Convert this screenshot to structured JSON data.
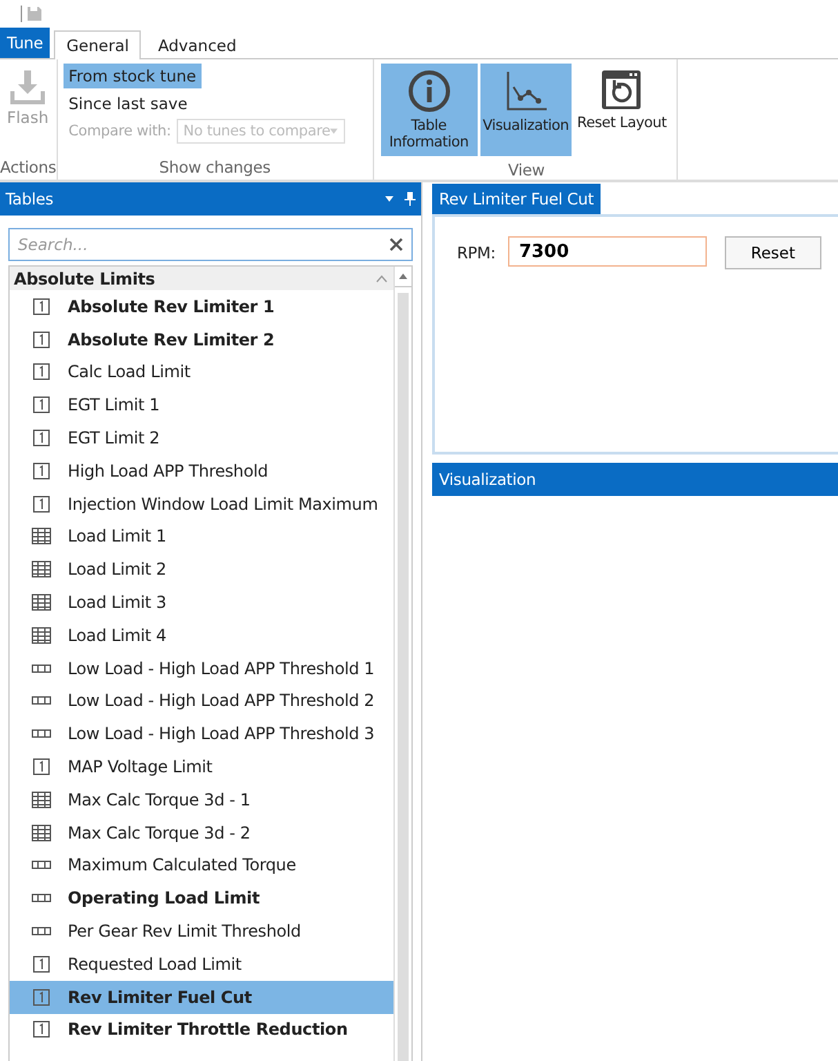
{
  "ribbon": {
    "app_tab": "Tune",
    "tabs": [
      {
        "label": "General",
        "selected": true
      },
      {
        "label": "Advanced",
        "selected": false
      }
    ],
    "groups": [
      {
        "kind": "actions",
        "label": "Actions",
        "flash": {
          "label": "Flash",
          "disabled": true
        }
      },
      {
        "kind": "changes",
        "label": "Show changes",
        "options": [
          {
            "label": "From stock tune",
            "selected": true
          },
          {
            "label": "Since last save",
            "selected": false
          }
        ],
        "compare": {
          "label": "Compare with:",
          "placeholder": "No tunes to compare",
          "disabled": true
        }
      },
      {
        "kind": "view",
        "label": "View",
        "buttons": [
          {
            "kind": "info",
            "label": "Table Information",
            "selected": true
          },
          {
            "kind": "chart",
            "label": "Visualization",
            "selected": true
          },
          {
            "kind": "reset",
            "label": "Reset Layout",
            "selected": false
          }
        ]
      }
    ]
  },
  "tables_panel": {
    "title": "Tables",
    "search": {
      "placeholder": "Search..."
    },
    "group": {
      "label": "Absolute Limits",
      "expanded": true
    },
    "items": [
      {
        "kind": "scalar",
        "label": "Absolute Rev Limiter 1",
        "modified": true,
        "selected": false
      },
      {
        "kind": "scalar",
        "label": "Absolute Rev Limiter 2",
        "modified": true,
        "selected": false
      },
      {
        "kind": "scalar",
        "label": "Calc Load Limit",
        "modified": false,
        "selected": false
      },
      {
        "kind": "scalar",
        "label": "EGT Limit 1",
        "modified": false,
        "selected": false
      },
      {
        "kind": "scalar",
        "label": "EGT Limit 2",
        "modified": false,
        "selected": false
      },
      {
        "kind": "scalar",
        "label": "High Load APP Threshold",
        "modified": false,
        "selected": false
      },
      {
        "kind": "scalar",
        "label": "Injection Window Load Limit Maximum",
        "modified": false,
        "selected": false
      },
      {
        "kind": "table",
        "label": "Load Limit 1",
        "modified": false,
        "selected": false
      },
      {
        "kind": "table",
        "label": "Load Limit 2",
        "modified": false,
        "selected": false
      },
      {
        "kind": "table",
        "label": "Load Limit 3",
        "modified": false,
        "selected": false
      },
      {
        "kind": "table",
        "label": "Load Limit 4",
        "modified": false,
        "selected": false
      },
      {
        "kind": "row",
        "label": "Low Load - High Load APP Threshold 1",
        "modified": false,
        "selected": false
      },
      {
        "kind": "row",
        "label": "Low Load - High Load APP Threshold 2",
        "modified": false,
        "selected": false
      },
      {
        "kind": "row",
        "label": "Low Load - High Load APP Threshold 3",
        "modified": false,
        "selected": false
      },
      {
        "kind": "scalar",
        "label": "MAP Voltage Limit",
        "modified": false,
        "selected": false
      },
      {
        "kind": "table",
        "label": "Max Calc Torque 3d - 1",
        "modified": false,
        "selected": false
      },
      {
        "kind": "table",
        "label": "Max Calc Torque 3d - 2",
        "modified": false,
        "selected": false
      },
      {
        "kind": "row",
        "label": "Maximum Calculated Torque",
        "modified": false,
        "selected": false
      },
      {
        "kind": "row",
        "label": "Operating Load Limit",
        "modified": true,
        "selected": false
      },
      {
        "kind": "row",
        "label": "Per Gear Rev Limit Threshold",
        "modified": false,
        "selected": false
      },
      {
        "kind": "scalar",
        "label": "Requested Load Limit",
        "modified": false,
        "selected": false
      },
      {
        "kind": "scalar",
        "label": "Rev Limiter Fuel Cut",
        "modified": true,
        "selected": true
      },
      {
        "kind": "scalar",
        "label": "Rev Limiter Throttle Reduction",
        "modified": true,
        "selected": false
      }
    ]
  },
  "editor": {
    "tab": "Rev Limiter Fuel Cut",
    "field_label": "RPM:",
    "value": "7300",
    "reset": "Reset"
  },
  "visualization": {
    "title": "Visualization"
  }
}
